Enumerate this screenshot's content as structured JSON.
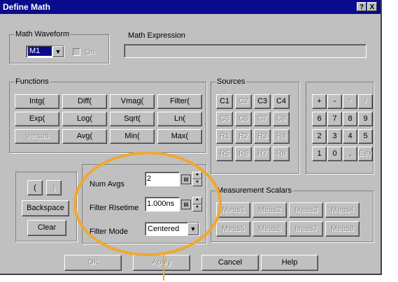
{
  "window": {
    "title": "Define Math",
    "help_label": "?",
    "close_label": "X"
  },
  "math_waveform": {
    "label": "Math Waveform",
    "selected": "M1",
    "on_label": "On",
    "on_checked": false,
    "expression_label": "Math Expression",
    "expression_value": ""
  },
  "functions": {
    "label": "Functions",
    "buttons": [
      "Intg(",
      "Diff(",
      "Vmag(",
      "Filter(",
      "Exp(",
      "Log(",
      "Sqrt(",
      "Ln(",
      "Versus",
      "Avg(",
      "Min(",
      "Max("
    ]
  },
  "sources": {
    "label": "Sources",
    "buttons": [
      "C1",
      "C2",
      "C3",
      "C4",
      "C5",
      "C6",
      "C7",
      "C8",
      "R1",
      "R2",
      "R3",
      "R4",
      "R5",
      "R6",
      "R7",
      "R8"
    ]
  },
  "keypad": {
    "buttons": [
      "+",
      "-",
      "*",
      "/",
      "6",
      "7",
      "8",
      "9",
      "2",
      "3",
      "4",
      "5",
      "1",
      "0",
      ".",
      "Eex"
    ]
  },
  "edit": {
    "open_paren": "(",
    "close_paren": ")",
    "backspace": "Backspace",
    "clear": "Clear"
  },
  "params": {
    "num_avgs_label": "Num Avgs",
    "num_avgs_value": "2",
    "rise_label": "Filter Risetime",
    "rise_value": "1.000ns",
    "mode_label": "Filter Mode",
    "mode_value": "Centered",
    "keyboard_icon": "keyboard-icon"
  },
  "measurement": {
    "label": "Measurement Scalars",
    "buttons": [
      "Meas1",
      "Meas2",
      "Meas3",
      "Meas4",
      "Meas5",
      "Meas6",
      "Meas7",
      "Meas8"
    ]
  },
  "footer": {
    "ok": "OK",
    "apply": "Apply",
    "cancel": "Cancel",
    "help": "Help"
  },
  "highlight_color": "#f0a830"
}
